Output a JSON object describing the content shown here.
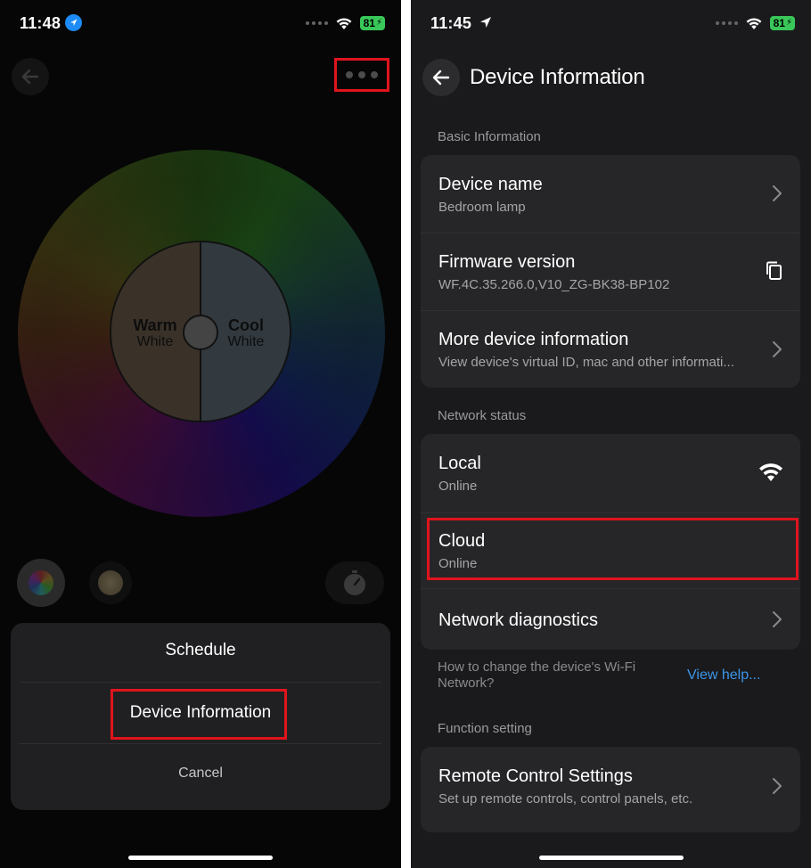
{
  "left_screen": {
    "status": {
      "time": "11:48",
      "battery": "81"
    },
    "wheel": {
      "warm_title": "Warm",
      "warm_sub": "White",
      "cool_title": "Cool",
      "cool_sub": "White"
    },
    "action_sheet": {
      "items": [
        "Schedule",
        "Device Information"
      ],
      "cancel": "Cancel"
    }
  },
  "right_screen": {
    "status": {
      "time": "11:45",
      "battery": "81"
    },
    "title": "Device Information",
    "basic_section": {
      "label": "Basic Information",
      "rows": [
        {
          "title": "Device name",
          "subtitle": "Bedroom lamp",
          "icon": "chevron-right-icon"
        },
        {
          "title": "Firmware version",
          "subtitle": "WF.4C.35.266.0,V10_ZG-BK38-BP102",
          "icon": "copy-icon"
        },
        {
          "title": "More device information",
          "subtitle": "View device's virtual ID, mac and other informati...",
          "icon": "chevron-right-icon"
        }
      ]
    },
    "network_section": {
      "label": "Network status",
      "rows": [
        {
          "title": "Local",
          "subtitle": "Online",
          "icon": "wifi-icon"
        },
        {
          "title": "Cloud",
          "subtitle": "Online",
          "icon": ""
        },
        {
          "title": "Network diagnostics",
          "subtitle": "",
          "icon": "chevron-right-icon"
        }
      ]
    },
    "help": {
      "text": "How to change the device's Wi-Fi Network?",
      "link": "View help..."
    },
    "function_section": {
      "label": "Function setting",
      "rows": [
        {
          "title": "Remote Control Settings",
          "subtitle": "Set up remote controls, control panels, etc.",
          "icon": "chevron-right-icon"
        }
      ]
    }
  },
  "colors": {
    "highlight": "#e0141c",
    "link": "#3b95e8",
    "battery": "#39c759"
  }
}
